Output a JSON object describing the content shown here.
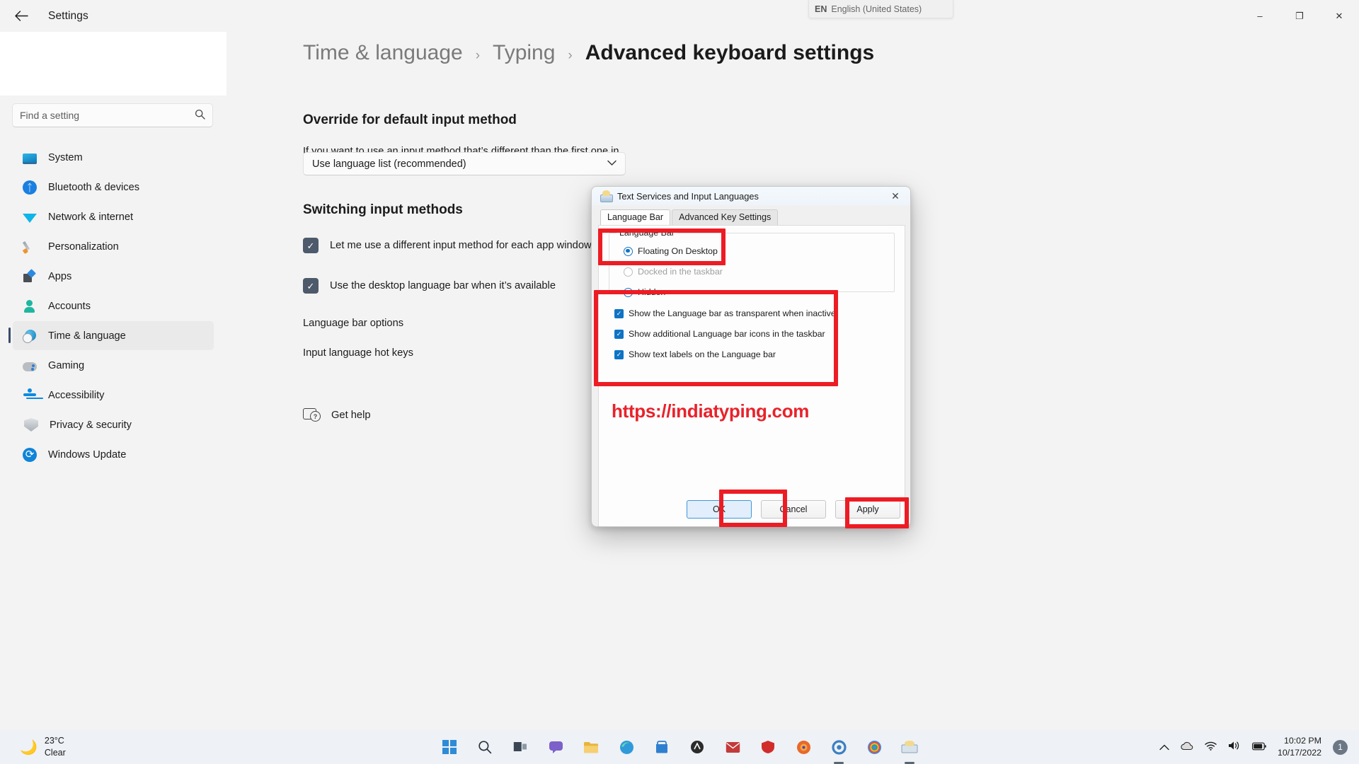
{
  "window": {
    "title": "Settings",
    "back_icon": "arrow-left-icon",
    "minimize": "–",
    "maximize": "❐",
    "close": "✕"
  },
  "language_indicator": {
    "code": "EN",
    "label": "English (United States)",
    "expand_icon": "expand-icon"
  },
  "search": {
    "placeholder": "Find a setting",
    "icon": "search-icon"
  },
  "sidebar": {
    "items": [
      {
        "label": "System",
        "icon": "monitor-icon",
        "active": false
      },
      {
        "label": "Bluetooth & devices",
        "icon": "bluetooth-icon",
        "active": false
      },
      {
        "label": "Network & internet",
        "icon": "wifi-icon",
        "active": false
      },
      {
        "label": "Personalization",
        "icon": "paintbrush-icon",
        "active": false
      },
      {
        "label": "Apps",
        "icon": "apps-icon",
        "active": false
      },
      {
        "label": "Accounts",
        "icon": "person-icon",
        "active": false
      },
      {
        "label": "Time & language",
        "icon": "clock-globe-icon",
        "active": true
      },
      {
        "label": "Gaming",
        "icon": "gamepad-icon",
        "active": false
      },
      {
        "label": "Accessibility",
        "icon": "accessibility-icon",
        "active": false
      },
      {
        "label": "Privacy & security",
        "icon": "shield-icon",
        "active": false
      },
      {
        "label": "Windows Update",
        "icon": "update-icon",
        "active": false
      }
    ]
  },
  "breadcrumb": {
    "level1": "Time & language",
    "sep1": "›",
    "level2": "Typing",
    "sep2": "›",
    "current": "Advanced keyboard settings"
  },
  "main": {
    "override_heading": "Override for default input method",
    "override_desc": "If you want to use an input method that’s different than the first one in your language list, choose it here",
    "override_value": "Use language list (recommended)",
    "override_chevron": "⌄",
    "switching_heading": "Switching input methods",
    "checkbox1": "Let me use a different input method for each app window",
    "checkbox2": "Use the desktop language bar when it’s available",
    "check_glyph": "✓",
    "link1": "Language bar options",
    "link2": "Input language hot keys",
    "get_help": "Get help",
    "get_help_icon": "help-icon"
  },
  "dialog": {
    "title": "Text Services and Input Languages",
    "title_icon": "keyboard-icon",
    "close_icon": "✕",
    "tabs": [
      {
        "label": "Language Bar",
        "active": true
      },
      {
        "label": "Advanced Key Settings",
        "active": false
      }
    ],
    "group_legend": "Language Bar",
    "radios": [
      {
        "label": "Floating On Desktop",
        "selected": true,
        "disabled": false
      },
      {
        "label": "Docked in the taskbar",
        "selected": false,
        "disabled": true
      },
      {
        "label": "Hidden",
        "selected": false,
        "disabled": false
      }
    ],
    "checkboxes": [
      {
        "label": "Show the Language bar as transparent when inactive",
        "checked": true
      },
      {
        "label": "Show additional Language bar icons in the taskbar",
        "checked": true
      },
      {
        "label": "Show text labels on the Language bar",
        "checked": true
      }
    ],
    "check_glyph": "✓",
    "watermark": "https://indiatyping.com",
    "buttons": {
      "ok": "OK",
      "cancel": "Cancel",
      "apply": "Apply"
    }
  },
  "taskbar": {
    "weather_temp": "23°C",
    "weather_cond": "Clear",
    "weather_icon": "moon-icon",
    "icons": [
      {
        "name": "start-icon",
        "glyph": "❖",
        "color": "#2e8bd6",
        "active": false
      },
      {
        "name": "search-icon",
        "glyph": "⌕",
        "color": "#4b5563",
        "active": false
      },
      {
        "name": "task-view-icon",
        "glyph": "▭",
        "color": "#4b5563",
        "active": false
      },
      {
        "name": "chat-icon",
        "glyph": "●",
        "color": "#7b61c9",
        "active": false
      },
      {
        "name": "file-explorer-icon",
        "glyph": "▰",
        "color": "#e8b43c",
        "active": false
      },
      {
        "name": "edge-icon",
        "glyph": "◔",
        "color": "#2f9ad9",
        "active": false
      },
      {
        "name": "store-icon",
        "glyph": "▣",
        "color": "#2f7fd0",
        "active": false
      },
      {
        "name": "app-icon",
        "glyph": "◆",
        "color": "#2b2b2b",
        "active": false
      },
      {
        "name": "mail-icon",
        "glyph": "✉",
        "color": "#c33a3a",
        "active": false
      },
      {
        "name": "shield-app-icon",
        "glyph": "▼",
        "color": "#d12c2c",
        "active": false
      },
      {
        "name": "firefox-icon",
        "glyph": "●",
        "color": "#e8682a",
        "active": false
      },
      {
        "name": "settings-icon",
        "glyph": "⚙",
        "color": "#3c7fc4",
        "active": true
      },
      {
        "name": "chrome-icon",
        "glyph": "◎",
        "color": "#3a8ee6",
        "active": false
      },
      {
        "name": "keyboard-app-icon",
        "glyph": "⌨",
        "color": "#e0c36a",
        "active": true
      }
    ],
    "tray": {
      "chevron": "⌃",
      "cloud": "☁",
      "wifi": "◠",
      "volume": "ὐA",
      "battery": "▮",
      "time": "10:02 PM",
      "date": "10/17/2022",
      "badge": "1"
    }
  }
}
